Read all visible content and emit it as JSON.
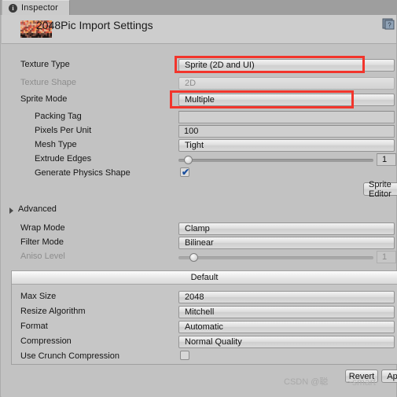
{
  "window": {
    "tab_label": "Inspector",
    "tab_icon": "info-icon",
    "help_icon": "help-book-icon",
    "title": "2048Pic Import Settings",
    "thumbnail": "texture-thumbnail"
  },
  "accent": {
    "annotation_red": "#f2352c",
    "panel_bg": "#c2c2c2",
    "header_bg": "#cdcdcd",
    "tabbar_bg": "#9e9e9e"
  },
  "settings": {
    "texture_type": {
      "label": "Texture Type",
      "value": "Sprite (2D and UI)",
      "highlighted": true
    },
    "texture_shape": {
      "label": "Texture Shape",
      "value": "2D",
      "disabled": true
    },
    "sprite_mode": {
      "label": "Sprite Mode",
      "value": "Multiple",
      "highlighted": true
    },
    "packing_tag": {
      "label": "Packing Tag",
      "value": ""
    },
    "pixels_per_unit": {
      "label": "Pixels Per Unit",
      "value": "100"
    },
    "mesh_type": {
      "label": "Mesh Type",
      "value": "Tight"
    },
    "extrude_edges": {
      "label": "Extrude Edges",
      "value": "1",
      "slider_pct": 3
    },
    "generate_physics_shape": {
      "label": "Generate Physics Shape",
      "checked": true,
      "checkmark": "✔"
    },
    "sprite_editor_button": "Sprite Editor"
  },
  "advanced": {
    "label": "Advanced",
    "expanded": false,
    "foldout_icon": "triangle-right-icon"
  },
  "texture_settings": {
    "wrap_mode": {
      "label": "Wrap Mode",
      "value": "Clamp"
    },
    "filter_mode": {
      "label": "Filter Mode",
      "value": "Bilinear"
    },
    "aniso_level": {
      "label": "Aniso Level",
      "value": "1",
      "disabled": true,
      "slider_pct": 6
    }
  },
  "platform": {
    "tab_label": "Default",
    "rows": [
      {
        "label": "Max Size",
        "value": "2048",
        "type": "popup"
      },
      {
        "label": "Resize Algorithm",
        "value": "Mitchell",
        "type": "popup"
      },
      {
        "label": "Format",
        "value": "Automatic",
        "type": "popup"
      },
      {
        "label": "Compression",
        "value": "Normal Quality",
        "type": "popup"
      },
      {
        "label": "Use Crunch Compression",
        "value": "",
        "type": "checkbox",
        "checked": false
      }
    ]
  },
  "footer": {
    "revert_button": "Revert",
    "apply_button": "Apply"
  },
  "watermark": {
    "text": "CSDN @聪",
    "text2": "~smart"
  }
}
